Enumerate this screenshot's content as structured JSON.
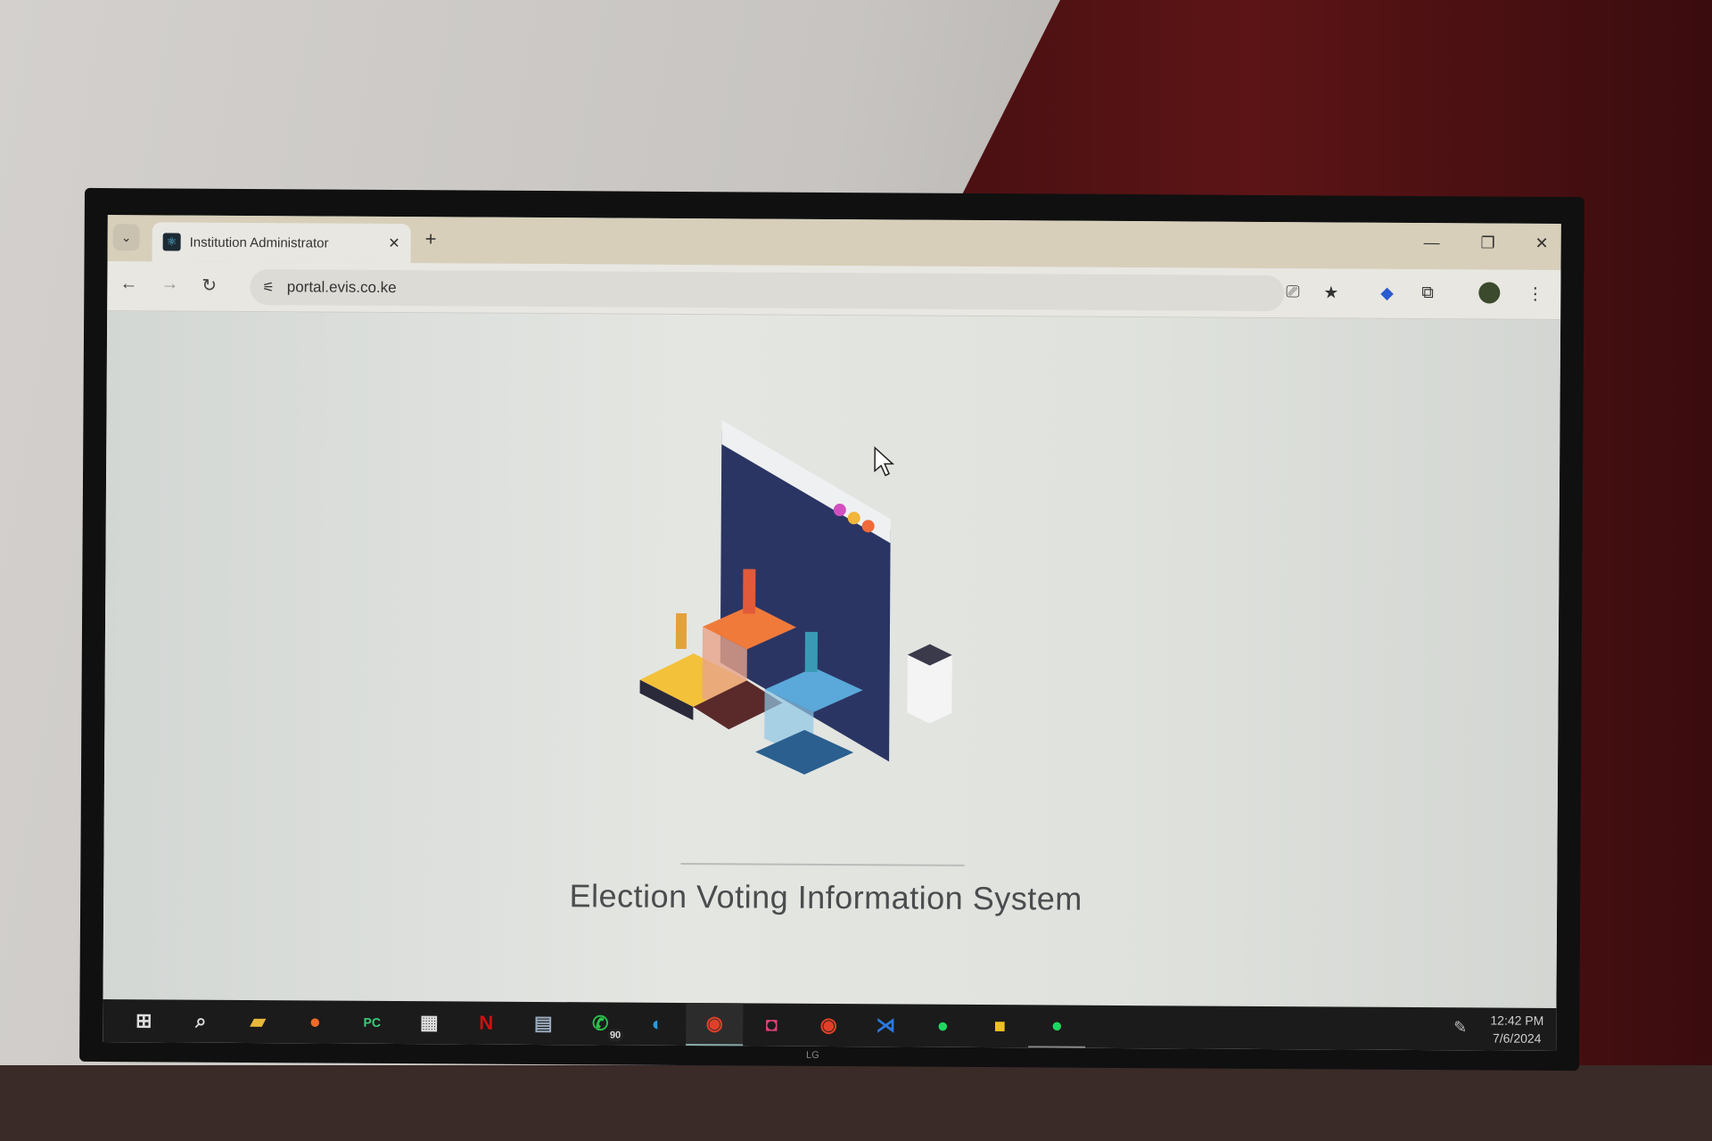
{
  "browser": {
    "tab_title": "Institution Administrator",
    "url": "portal.evis.co.ke",
    "icons": [
      "tab-search-icon",
      "react-favicon",
      "close-icon",
      "new-tab-icon",
      "minimize-icon",
      "restore-icon",
      "close-window-icon",
      "back-icon",
      "forward-icon",
      "reload-icon",
      "site-settings-icon",
      "install-app-icon",
      "bookmark-star-icon",
      "extension-icon",
      "puzzle-extensions-icon",
      "profile-avatar",
      "more-menu-icon"
    ]
  },
  "page": {
    "title": "Election Voting Information System"
  },
  "taskbar": {
    "apps": [
      "start",
      "search",
      "file-explorer",
      "firefox",
      "pycharm",
      "microsoft-store",
      "netflix",
      "scanner",
      "whatsapp",
      "edge",
      "chrome",
      "instagram",
      "chrome-profile",
      "vscode",
      "spotify",
      "sticky-notes",
      "spotify-2"
    ],
    "whatsapp_badge": "90",
    "time": "12:42 PM",
    "date": "7/6/2024"
  },
  "monitor": {
    "brand": "LG"
  },
  "colors": {
    "accent": "#f07a3a",
    "screen_dark": "#2a3560"
  }
}
